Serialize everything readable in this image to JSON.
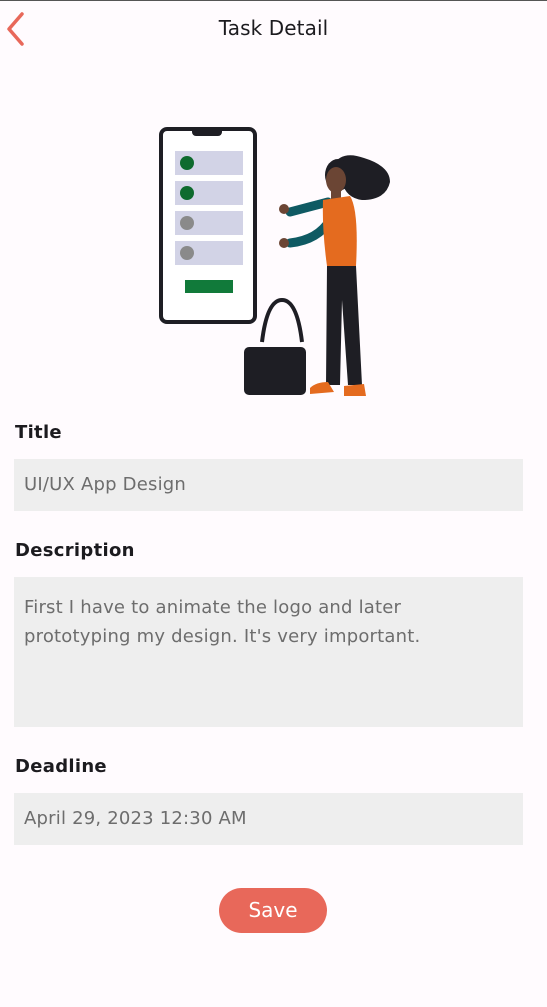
{
  "appbar": {
    "title": "Task Detail",
    "back_icon": "chevron-left-icon"
  },
  "colors": {
    "accent": "#e8685a",
    "background": "#fffbfe",
    "field_background": "#eeeeee"
  },
  "illustration": {
    "name": "woman-with-phone-checklist-illustration"
  },
  "form": {
    "title": {
      "label": "Title",
      "value": "UI/UX App Design"
    },
    "description": {
      "label": "Description",
      "value": "First I have to animate the logo and later prototyping my design. It's very important."
    },
    "deadline": {
      "label": "Deadline",
      "value": "April 29, 2023 12:30 AM"
    }
  },
  "actions": {
    "save_label": "Save"
  }
}
